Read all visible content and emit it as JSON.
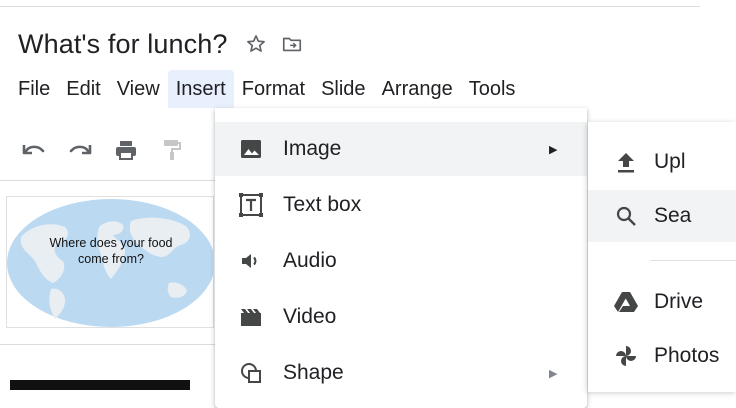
{
  "document": {
    "title": "What's for lunch?"
  },
  "menubar": {
    "items": [
      {
        "label": "File"
      },
      {
        "label": "Edit"
      },
      {
        "label": "View"
      },
      {
        "label": "Insert",
        "open": true
      },
      {
        "label": "Format"
      },
      {
        "label": "Slide"
      },
      {
        "label": "Arrange"
      },
      {
        "label": "Tools"
      }
    ]
  },
  "toolbar": {
    "icons": [
      "undo-icon",
      "redo-icon",
      "print-icon",
      "paint-format-icon"
    ]
  },
  "slide_panel": {
    "thumbnail_text": "Where does your food\ncome from?"
  },
  "insert_menu": {
    "items": [
      {
        "label": "Image",
        "icon": "image-icon",
        "has_submenu": true,
        "active": true
      },
      {
        "label": "Text box",
        "icon": "text-box-icon",
        "has_submenu": false
      },
      {
        "label": "Audio",
        "icon": "audio-icon",
        "has_submenu": false
      },
      {
        "label": "Video",
        "icon": "video-icon",
        "has_submenu": false
      },
      {
        "label": "Shape",
        "icon": "shape-icon",
        "has_submenu": true
      }
    ]
  },
  "image_submenu": {
    "items": [
      {
        "label": "Upl",
        "icon": "upload-icon"
      },
      {
        "label": "Sea",
        "icon": "search-icon",
        "hover": true
      },
      {
        "label": "Drive",
        "icon": "drive-icon"
      },
      {
        "label": "Photos",
        "icon": "photos-icon"
      }
    ]
  },
  "colors": {
    "menu_open_bg": "#e8f0fe",
    "menu_item_active_bg": "#f1f3f4",
    "icon_gray": "#5f6368"
  }
}
